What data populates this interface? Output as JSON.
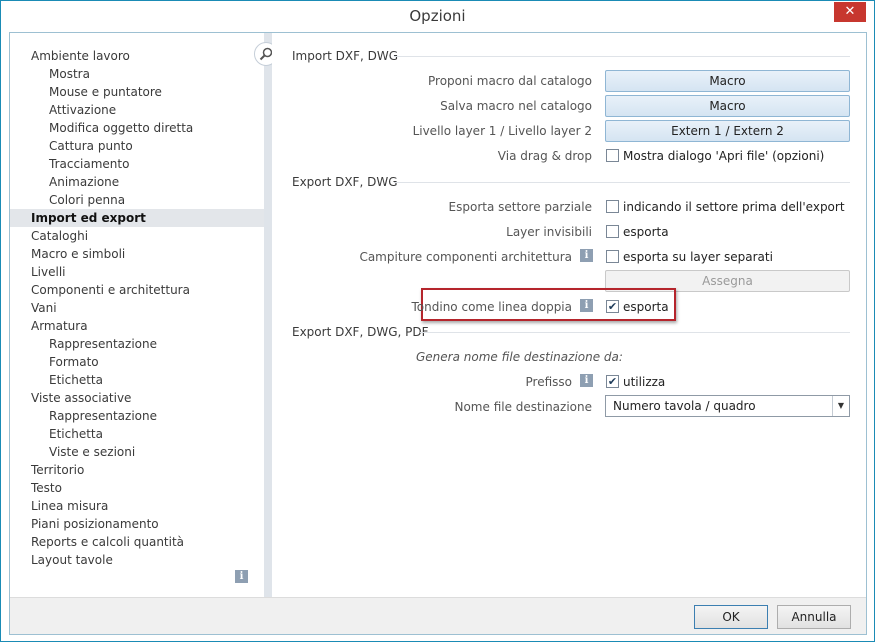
{
  "window": {
    "title": "Opzioni",
    "close_glyph": "✕"
  },
  "sidebar": {
    "search_icon": "magnifier-icon",
    "info_glyph": "i",
    "items": [
      {
        "label": "Ambiente lavoro",
        "level": 0
      },
      {
        "label": "Mostra",
        "level": 1
      },
      {
        "label": "Mouse e puntatore",
        "level": 1
      },
      {
        "label": "Attivazione",
        "level": 1
      },
      {
        "label": "Modifica oggetto diretta",
        "level": 1
      },
      {
        "label": "Cattura punto",
        "level": 1
      },
      {
        "label": "Tracciamento",
        "level": 1
      },
      {
        "label": "Animazione",
        "level": 1
      },
      {
        "label": "Colori penna",
        "level": 1
      },
      {
        "label": "Import ed export",
        "level": 0,
        "active": true
      },
      {
        "label": "Cataloghi",
        "level": 0
      },
      {
        "label": "Macro e simboli",
        "level": 0
      },
      {
        "label": "Livelli",
        "level": 0
      },
      {
        "label": "Componenti e architettura",
        "level": 0
      },
      {
        "label": "Vani",
        "level": 0
      },
      {
        "label": "Armatura",
        "level": 0
      },
      {
        "label": "Rappresentazione",
        "level": 1
      },
      {
        "label": "Formato",
        "level": 1
      },
      {
        "label": "Etichetta",
        "level": 1
      },
      {
        "label": "Viste associative",
        "level": 0
      },
      {
        "label": "Rappresentazione",
        "level": 1
      },
      {
        "label": "Etichetta",
        "level": 1
      },
      {
        "label": "Viste e sezioni",
        "level": 1
      },
      {
        "label": "Territorio",
        "level": 0
      },
      {
        "label": "Testo",
        "level": 0
      },
      {
        "label": "Linea misura",
        "level": 0
      },
      {
        "label": "Piani posizionamento",
        "level": 0
      },
      {
        "label": "Reports e calcoli quantità",
        "level": 0
      },
      {
        "label": "Layout tavole",
        "level": 0
      }
    ]
  },
  "main": {
    "section_import": {
      "title": "Import DXF, DWG",
      "proponi_label": "Proponi macro dal catalogo",
      "proponi_button": "Macro",
      "salva_label": "Salva macro nel catalogo",
      "salva_button": "Macro",
      "livello_label": "Livello layer 1 / Livello layer 2",
      "livello_button": "Extern 1 / Extern 2",
      "drag_label": "Via drag & drop",
      "drag_checkbox": "Mostra dialogo 'Apri file' (opzioni)",
      "drag_checked": false
    },
    "section_export": {
      "title": "Export DXF, DWG",
      "settore_label": "Esporta settore parziale",
      "settore_checkbox": "indicando il settore prima dell'export",
      "settore_checked": false,
      "layer_label": "Layer invisibili",
      "layer_checkbox": "esporta",
      "layer_checked": false,
      "campiture_label": "Campiture componenti architettura",
      "campiture_checkbox": "esporta su layer separati",
      "campiture_checked": false,
      "assegna_button": "Assegna",
      "tondino_label": "Tondino come linea doppia",
      "tondino_checkbox": "esporta",
      "tondino_checked": true
    },
    "section_pdf": {
      "title": "Export DXF, DWG, PDF",
      "genera_label": "Genera nome file destinazione da:",
      "prefisso_label": "Prefisso",
      "prefisso_checkbox": "utilizza",
      "prefisso_checked": true,
      "nome_label": "Nome file destinazione",
      "nome_value": "Numero tavola / quadro"
    },
    "info_glyph": "i",
    "check_glyph": "✔"
  },
  "footer": {
    "ok_label": "OK",
    "cancel_label": "Annulla"
  },
  "colors": {
    "accent": "#1a8bb5",
    "highlight": "#b5252c",
    "active_item": "#e3e6ea",
    "close": "#c7372f"
  }
}
